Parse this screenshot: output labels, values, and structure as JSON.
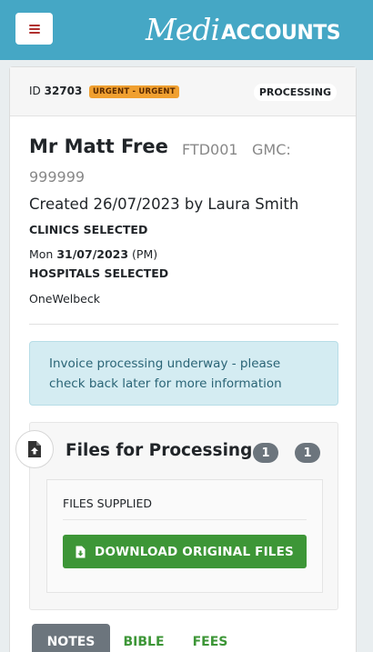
{
  "header": {
    "menu_icon": "hamburger-icon",
    "logo_medi": "Medi",
    "logo_accounts": "ACCOUNTS"
  },
  "case": {
    "id_prefix": "ID",
    "id_value": "32703",
    "urgency_badge": "URGENT - URGENT",
    "status": "PROCESSING",
    "patient_name": "Mr Matt Free",
    "patient_ref": "FTD001",
    "gmc_label": "GMC:",
    "gmc_number": "999999",
    "created": "Created 26/07/2023 by Laura Smith",
    "clinics_heading": "CLINICS SELECTED",
    "clinic_day": "Mon",
    "clinic_date": "31/07/2023",
    "clinic_session": "(PM)",
    "hospitals_heading": "HOSPITALS SELECTED",
    "hospital_name": "OneWelbeck"
  },
  "alert": {
    "message": "Invoice processing underway - please check back later for more information"
  },
  "files": {
    "icon": "file-upload-icon",
    "title": "Files for Processing",
    "badge_a": "1",
    "badge_b": "1",
    "supplied_label": "FILES SUPPLIED",
    "download_icon": "file-download-icon",
    "download_label": "DOWNLOAD ORIGINAL FILES"
  },
  "tabs": [
    {
      "label": "NOTES",
      "active": true
    },
    {
      "label": "BIBLE",
      "active": false
    },
    {
      "label": "FEES",
      "active": false
    }
  ],
  "colors": {
    "topbar": "#45a7c5",
    "urgent": "#f0a030",
    "success": "#3d9637",
    "badge": "#6c757d",
    "alert_bg": "#d4ecf2",
    "alert_text": "#2a6476",
    "menu_icon": "#b0302f"
  }
}
